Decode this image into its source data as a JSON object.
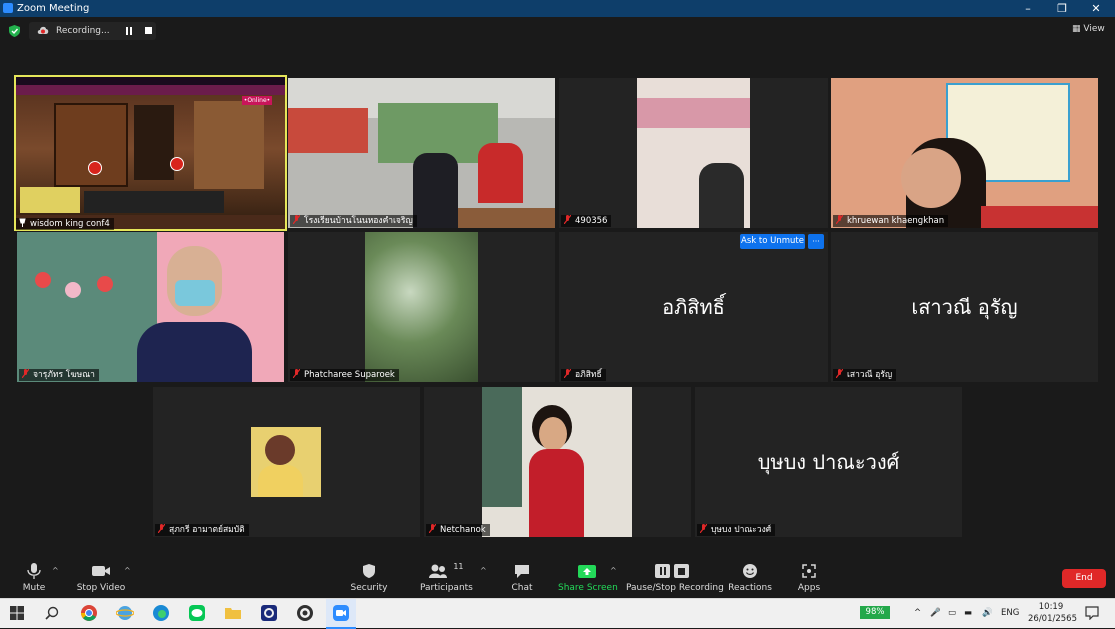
{
  "window": {
    "title": "Zoom Meeting",
    "minimize": "–",
    "maximize": "❐",
    "close": "✕"
  },
  "topbar": {
    "recording_label": "Recording...",
    "view_label": "View"
  },
  "tiles": [
    {
      "name": "wisdom king conf4",
      "active": true
    },
    {
      "name": "โรงเรียนบ้านโนนหองคำเจริญ"
    },
    {
      "name": "490356"
    },
    {
      "name": "khruewan khaengkhan"
    },
    {
      "name": "จารุภัทร  โฆษณา"
    },
    {
      "name": "Phatcharee Suparoek"
    },
    {
      "name": "อภิสิทธิ์",
      "big_name": "อภิสิทธิ์",
      "ask_unmute": "Ask to Unmute",
      "more": "···"
    },
    {
      "name": "เสาวณี อุรัญ",
      "big_name": "เสาวณี อุรัญ"
    },
    {
      "name": "สุภกรี อามาตย์สมบัติ"
    },
    {
      "name": "Netchanok"
    },
    {
      "name": "บุษบง  ปาณะวงศ์",
      "big_name": "บุษบง  ปาณะวงศ์"
    }
  ],
  "screen_share": {
    "online_badge": "•Online•"
  },
  "toolbar": {
    "mute": "Mute",
    "stop_video": "Stop Video",
    "security": "Security",
    "participants": "Participants",
    "participants_count": "11",
    "chat": "Chat",
    "share_screen": "Share Screen",
    "pause_stop_recording": "Pause/Stop Recording",
    "reactions": "Reactions",
    "apps": "Apps",
    "end": "End"
  },
  "taskbar": {
    "battery": "98%",
    "language": "ENG",
    "time": "10:19",
    "date": "26/01/2565"
  },
  "colors": {
    "active_speaker": "#e6e65a",
    "end": "#e02828",
    "share_green": "#23d959",
    "unmute_blue": "#0e72ed"
  }
}
